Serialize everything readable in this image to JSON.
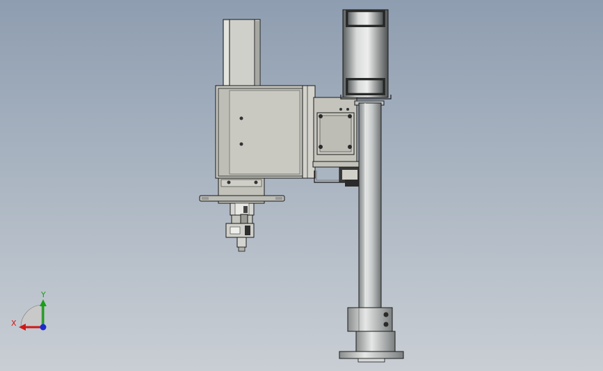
{
  "viewport": {
    "background_top": "#8e9db0",
    "background_bottom": "#c9ced4"
  },
  "triad": {
    "x_label": "X",
    "y_label": "Y",
    "x_color": "#d01818",
    "y_color": "#18a018",
    "z_color": "#1a2ad0"
  },
  "model": {
    "part_fill": "#c8c8c0",
    "metal_fill": "#b9bcbc",
    "edge_color": "#1a1a1a"
  }
}
